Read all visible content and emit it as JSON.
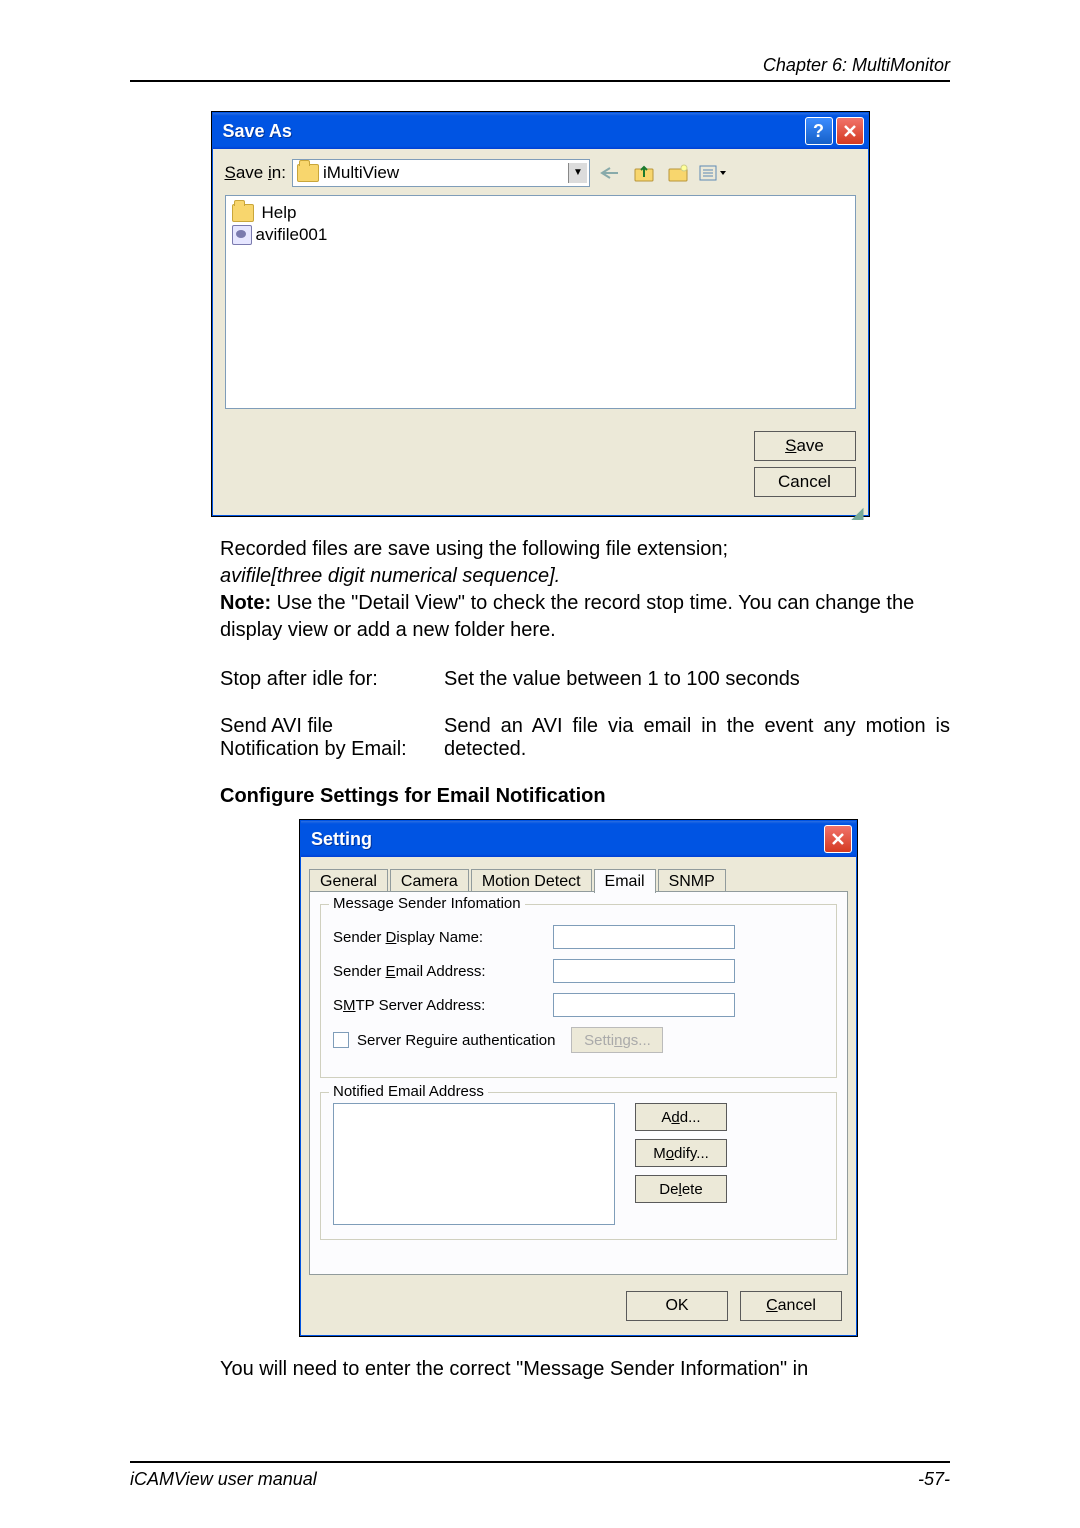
{
  "header": {
    "chapter": "Chapter 6: MultiMonitor"
  },
  "saveAs": {
    "title": "Save As",
    "saveInLabel": "Save in:",
    "saveInValue": "iMultiView",
    "files": [
      {
        "name": "Help",
        "icon": "folder"
      },
      {
        "name": "avifile001",
        "icon": "avi"
      }
    ],
    "saveBtn": "Save",
    "cancelBtn": "Cancel"
  },
  "body": {
    "line1": "Recorded files are save using the following file extension;",
    "line2": "avifile[three digit numerical sequence].",
    "note_label": "Note:",
    "note_text": " Use the \"Detail View\" to check the record stop time. You can change the display view or add a new folder here.",
    "kv": [
      {
        "left": "Stop after idle for:",
        "right": "Set the value between 1 to 100 seconds"
      },
      {
        "left": "Send AVI file Notification by Email:",
        "right": "Send an AVI file via email in the event any motion is detected."
      }
    ],
    "heading": "Configure Settings for Email Notification",
    "post": "You will need to enter the correct \"Message Sender Information\" in"
  },
  "settings": {
    "title": "Setting",
    "tabs": {
      "general": "General",
      "camera": "Camera",
      "motion": "Motion Detect",
      "email": "Email",
      "snmp": "SNMP"
    },
    "group1": {
      "legend": "Message Sender Infomation",
      "senderDisplay": "Sender Display Name:",
      "senderEmail": "Sender Email Address:",
      "smtp": "SMTP Server Address:",
      "auth": "Server Reguire authentication",
      "settingsBtn": "Settings..."
    },
    "group2": {
      "legend": "Notified Email Address",
      "add": "Add...",
      "modify": "Modify...",
      "delete": "Delete"
    },
    "ok": "OK",
    "cancel": "Cancel"
  },
  "footer": {
    "left": "iCAMView  user  manual",
    "right": "-57-"
  }
}
